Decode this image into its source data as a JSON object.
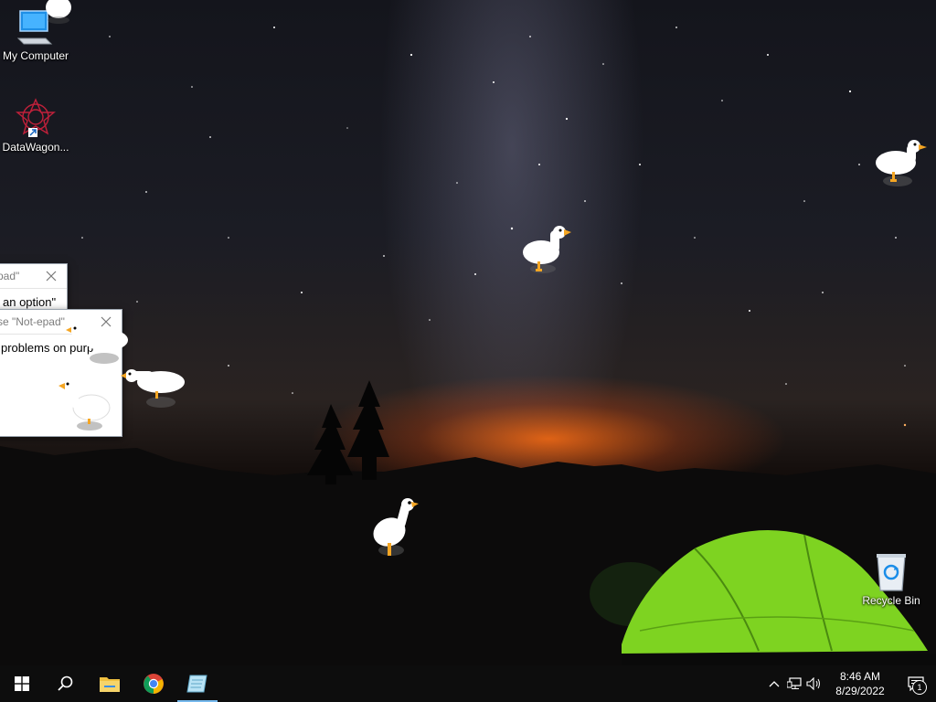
{
  "desktop": {
    "icons": [
      {
        "label": "My Computer",
        "icon": "computer-icon"
      },
      {
        "label": "DataWagon...",
        "icon": "datawagon-icon"
      },
      {
        "label": "Recycle Bin",
        "icon": "recycle-bin-icon"
      }
    ]
  },
  "dialogs": [
    {
      "title": "pad\"",
      "body": "an option\""
    },
    {
      "title": "se \"Not-epad\"",
      "body": "problems on purp"
    }
  ],
  "taskbar": {
    "buttons": [
      {
        "name": "start",
        "icon": "windows-logo-icon"
      },
      {
        "name": "search",
        "icon": "search-icon"
      },
      {
        "name": "file-explorer",
        "icon": "folder-icon"
      },
      {
        "name": "chrome",
        "icon": "chrome-icon"
      },
      {
        "name": "notepad-app",
        "icon": "notepad-icon",
        "active": true
      }
    ],
    "tray": {
      "icons": [
        "chevron-up-icon",
        "network-icon",
        "volume-icon"
      ],
      "time": "8:46 AM",
      "date": "8/29/2022",
      "notification_count": "1"
    }
  },
  "colors": {
    "taskbar": "#0d0d0d",
    "active_indicator": "#76b9ed",
    "horizon_glow": "#ff6e14",
    "tent": "#7ed321"
  }
}
